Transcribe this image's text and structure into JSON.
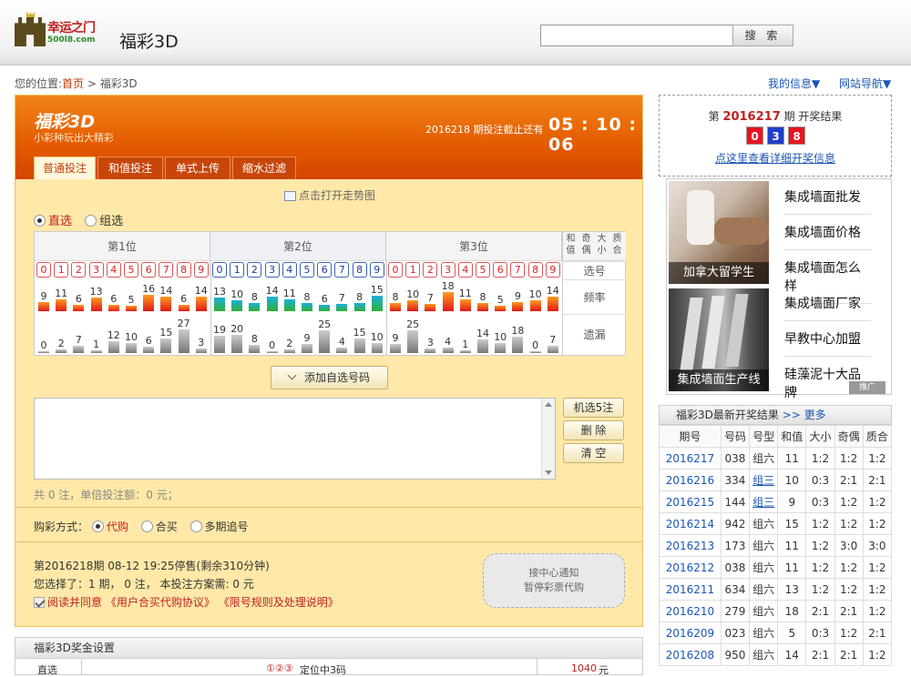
{
  "header": {
    "logo_text": "幸运之门",
    "logo_domain": "500l8.com",
    "site_title": "福彩3D",
    "search_placeholder": "",
    "search_button": "搜 索"
  },
  "breadcrumb": {
    "prefix": "您的位置:",
    "home": "首页",
    "sep": " > ",
    "current": "福彩3D"
  },
  "topnav": {
    "my_info": "我的信息▼",
    "site_nav": "网站导航▼"
  },
  "game": {
    "name": "福彩3D",
    "slogan": "小彩种玩出大精彩",
    "deadline_text": "2016218 期投注截止还有",
    "countdown": "05 : 10 : 06"
  },
  "tabs": [
    "普通投注",
    "和值投注",
    "单式上传",
    "缩水过滤"
  ],
  "trend_link": "点击打开走势图",
  "modes": {
    "direct": "直选",
    "group": "组选"
  },
  "positions": [
    "第1位",
    "第2位",
    "第3位"
  ],
  "side_headers": [
    "和值",
    "奇偶",
    "大小",
    "质合"
  ],
  "row_labels": {
    "pick": "选号",
    "freq": "频率",
    "miss": "遗漏"
  },
  "digits": [
    "0",
    "1",
    "2",
    "3",
    "4",
    "5",
    "6",
    "7",
    "8",
    "9"
  ],
  "freq": [
    [
      9,
      11,
      6,
      13,
      6,
      5,
      16,
      14,
      6,
      14
    ],
    [
      13,
      10,
      8,
      14,
      11,
      8,
      6,
      7,
      8,
      15
    ],
    [
      8,
      10,
      7,
      18,
      11,
      8,
      5,
      9,
      10,
      14
    ]
  ],
  "miss": [
    [
      0,
      2,
      7,
      1,
      12,
      10,
      6,
      15,
      27,
      3
    ],
    [
      19,
      20,
      8,
      0,
      2,
      9,
      25,
      4,
      15,
      10
    ],
    [
      9,
      25,
      3,
      4,
      1,
      14,
      10,
      18,
      0,
      7
    ]
  ],
  "add_button": "添加自选号码",
  "side_buttons": [
    "机选5注",
    "删 除",
    "清 空"
  ],
  "summary": "共 0 注，单倍投注额：0 元；",
  "purchase": {
    "label": "购彩方式：",
    "options": [
      "代购",
      "合买",
      "多期追号"
    ]
  },
  "issue_info": {
    "line1": "第2016218期 08-12 19:25停售(剩余310分钟)",
    "line2": "您选择了：1 期， 0 注， 本投注方案需: 0 元",
    "agree": "阅读并同意",
    "doc1": "《用户合买代购协议》",
    "doc2": "《限号规则及处理说明》"
  },
  "notice": {
    "line1": "接中心通知",
    "line2": "暂停彩票代购"
  },
  "prize": {
    "title": "福彩3D奖金设置",
    "row_type": "直选",
    "row_desc": "定位中3码",
    "row_amount": "1040",
    "row_unit": "元"
  },
  "latest_result": {
    "prefix": "第",
    "issue": "2016217",
    "suffix": "期 开奖结果",
    "balls": [
      "0",
      "3",
      "8"
    ],
    "ball_colors": [
      "#e8141e",
      "#1f3fc9",
      "#e8141e"
    ],
    "detail_link": "点这里查看详细开奖信息"
  },
  "ads": {
    "img1_caption": "加拿大留学生",
    "img2_caption": "集成墙面生产线",
    "links": [
      "集成墙面批发",
      "集成墙面价格",
      "集成墙面怎么样",
      "集成墙面厂家",
      "早教中心加盟",
      "硅藻泥十大品牌"
    ],
    "tag": "推广"
  },
  "lottery_table": {
    "title": "福彩3D最新开奖结果",
    "more": ">> 更多",
    "headers": [
      "期号",
      "号码",
      "号型",
      "和值",
      "大小",
      "奇偶",
      "质合"
    ],
    "rows": [
      [
        "2016217",
        "038",
        "组六",
        "11",
        "1:2",
        "1:2",
        "1:2"
      ],
      [
        "2016216",
        "334",
        "组三",
        "10",
        "0:3",
        "2:1",
        "2:1"
      ],
      [
        "2016215",
        "144",
        "组三",
        "9",
        "0:3",
        "1:2",
        "1:2"
      ],
      [
        "2016214",
        "942",
        "组六",
        "15",
        "1:2",
        "1:2",
        "1:2"
      ],
      [
        "2016213",
        "173",
        "组六",
        "11",
        "1:2",
        "3:0",
        "3:0"
      ],
      [
        "2016212",
        "038",
        "组六",
        "11",
        "1:2",
        "1:2",
        "1:2"
      ],
      [
        "2016211",
        "634",
        "组六",
        "13",
        "1:2",
        "1:2",
        "1:2"
      ],
      [
        "2016210",
        "279",
        "组六",
        "18",
        "2:1",
        "2:1",
        "1:2"
      ],
      [
        "2016209",
        "023",
        "组六",
        "5",
        "0:3",
        "1:2",
        "2:1"
      ],
      [
        "2016208",
        "950",
        "组六",
        "14",
        "2:1",
        "2:1",
        "1:2"
      ]
    ]
  }
}
